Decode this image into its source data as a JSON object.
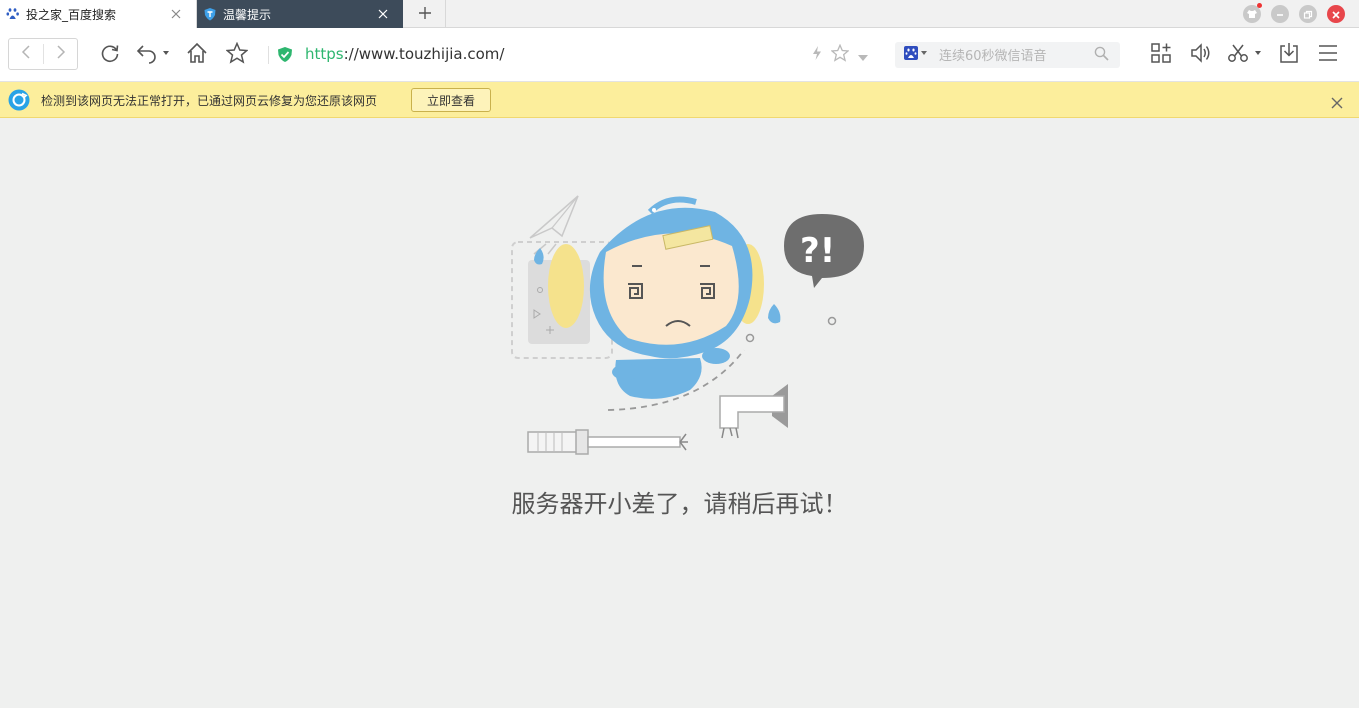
{
  "tabs": [
    {
      "title": "投之家_百度搜索",
      "active": false
    },
    {
      "title": "温馨提示",
      "active": true
    }
  ],
  "toolbar": {
    "url_scheme": "https",
    "url_rest": "://www.touzhijia.com/",
    "search_placeholder": "连续60秒微信语音"
  },
  "notice": {
    "message": "检测到该网页无法正常打开，已通过网页云修复为您还原该网页",
    "button_label": "立即查看"
  },
  "error": {
    "message": "服务器开小差了，请稍后再试！"
  },
  "colors": {
    "accent_green": "#2eb66f",
    "notice_bg": "#fcee9c",
    "active_tab_bg": "#3d4b5a",
    "mascot_blue": "#6fb4e3"
  },
  "icons": [
    "baidu-paw-icon",
    "shield-tab-icon",
    "close-icon",
    "plus-icon",
    "skin-icon",
    "minimize-icon",
    "restore-icon",
    "close-window-icon",
    "back-icon",
    "forward-icon",
    "refresh-icon",
    "undo-icon",
    "home-icon",
    "star-icon",
    "secure-shield-icon",
    "lightning-icon",
    "baidu-search-icon",
    "search-icon",
    "apps-icon",
    "speaker-icon",
    "scissors-icon",
    "download-icon",
    "menu-icon",
    "cloud-repair-icon"
  ]
}
